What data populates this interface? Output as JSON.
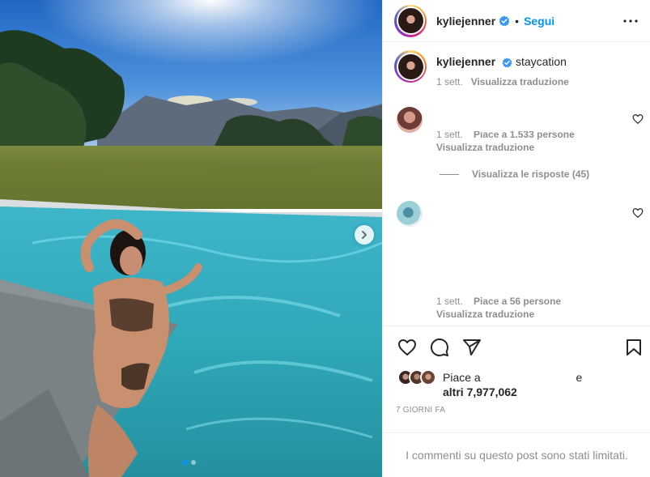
{
  "post": {
    "username": "kyliejenner",
    "follow_label": "Segui",
    "separator": "•",
    "caption_text": "staycation",
    "caption_time": "1 sett.",
    "translate_label": "Visualizza traduzione"
  },
  "comments": [
    {
      "time": "1 sett.",
      "likes_text": "Piace a 1.533 persone",
      "translate_label": "Visualizza traduzione",
      "replies_label": "Visualizza le risposte (45)"
    },
    {
      "time": "1 sett.",
      "likes_text": "Piace a 56 persone",
      "translate_label": "Visualizza traduzione"
    }
  ],
  "likes": {
    "line1_start": "Piace a",
    "line1_end": "e",
    "line2": "altri 7,977,062"
  },
  "date_label": "7 GIORNI FA",
  "limited_comments": "I commenti su questo post sono stati limitati.",
  "carousel": {
    "slides": 2,
    "current": 1
  },
  "icons": {
    "verified": "verified-badge-icon",
    "more": "more-options-icon",
    "like": "heart-icon",
    "comment": "comment-icon",
    "share": "share-icon",
    "save": "bookmark-icon",
    "next": "chevron-right-icon"
  },
  "colors": {
    "link": "#0095f6",
    "muted": "#8e8e8e",
    "text": "#262626"
  }
}
